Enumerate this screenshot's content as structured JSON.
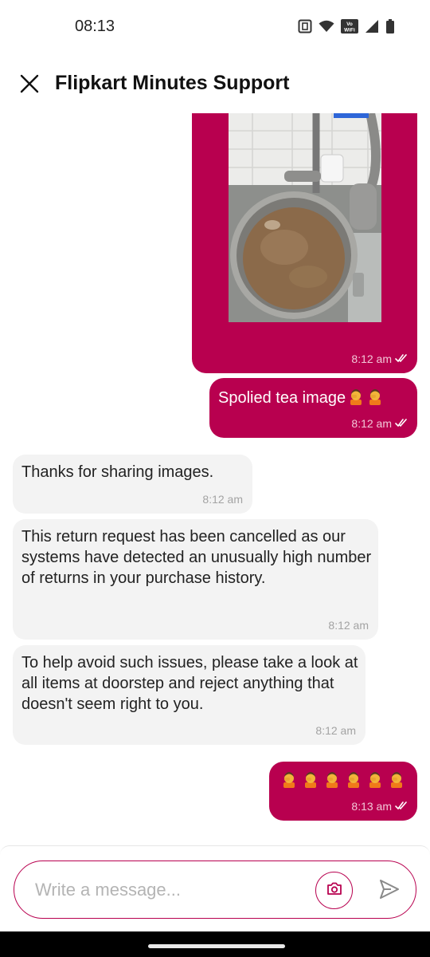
{
  "status_bar": {
    "time": "08:13",
    "icons": [
      "nfc-icon",
      "wifi-icon",
      "vowifi-icon",
      "signal-icon",
      "battery-icon"
    ],
    "vowifi_text": "Vo WiFi"
  },
  "header": {
    "title": "Flipkart Minutes Support",
    "close_icon": "close-icon"
  },
  "colors": {
    "accent": "#b8004f",
    "incoming_bubble": "#f3f3f3",
    "background": "#ffffff"
  },
  "messages": [
    {
      "direction": "outgoing",
      "type": "image",
      "image_description": "pot of tea",
      "time": "8:12 am",
      "status_icon": "double-tick-icon"
    },
    {
      "direction": "outgoing",
      "type": "text",
      "text": "Spolied tea image",
      "emoji_count": 2,
      "time": "8:12 am",
      "status_icon": "double-tick-icon"
    },
    {
      "direction": "incoming",
      "type": "text",
      "text": "Thanks for sharing images.",
      "time": "8:12 am"
    },
    {
      "direction": "incoming",
      "type": "text",
      "text": "This return request has been cancelled as our systems have detected an unusually high number of returns in your purchase history.",
      "time": "8:12 am"
    },
    {
      "direction": "incoming",
      "type": "text",
      "text": "To help avoid such issues, please take a look at all items at doorstep and reject anything that doesn't seem right to you.",
      "time": "8:12 am"
    },
    {
      "direction": "outgoing",
      "type": "emoji",
      "emoji": "face-palm",
      "emoji_count": 6,
      "time": "8:13 am",
      "status_icon": "double-tick-icon"
    }
  ],
  "composer": {
    "placeholder": "Write a message...",
    "value": "",
    "camera_icon": "camera-icon",
    "send_icon": "send-icon"
  }
}
